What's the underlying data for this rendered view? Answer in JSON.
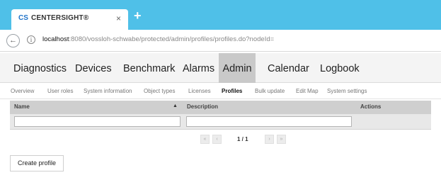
{
  "browser": {
    "tab": {
      "logo": "CS",
      "title": "CENTERSIGHT®",
      "close": "×"
    },
    "new_tab": "+",
    "address": {
      "host": "localhost",
      "path": ":8080/vossloh-schwabe/protected/admin/profiles/profiles.do?nodeId="
    }
  },
  "main_nav": {
    "items": [
      "Diagnostics",
      "Devices",
      "Benchmark",
      "Alarms",
      "Admin",
      "Calendar",
      "Logbook"
    ],
    "active": "Admin"
  },
  "sub_nav": {
    "items": [
      "Overview",
      "User roles",
      "System information",
      "Object types",
      "Licenses",
      "Profiles",
      "Bulk update",
      "Edit Map",
      "System settings"
    ],
    "active": "Profiles"
  },
  "table": {
    "columns": [
      "Name",
      "Description",
      "Actions"
    ],
    "sort_indicator": "▲",
    "name_filter": "",
    "description_filter": ""
  },
  "pagination": {
    "first": "«",
    "prev": "‹",
    "info": "1 / 1",
    "next": "›",
    "last": "»"
  },
  "create_button": "Create profile"
}
